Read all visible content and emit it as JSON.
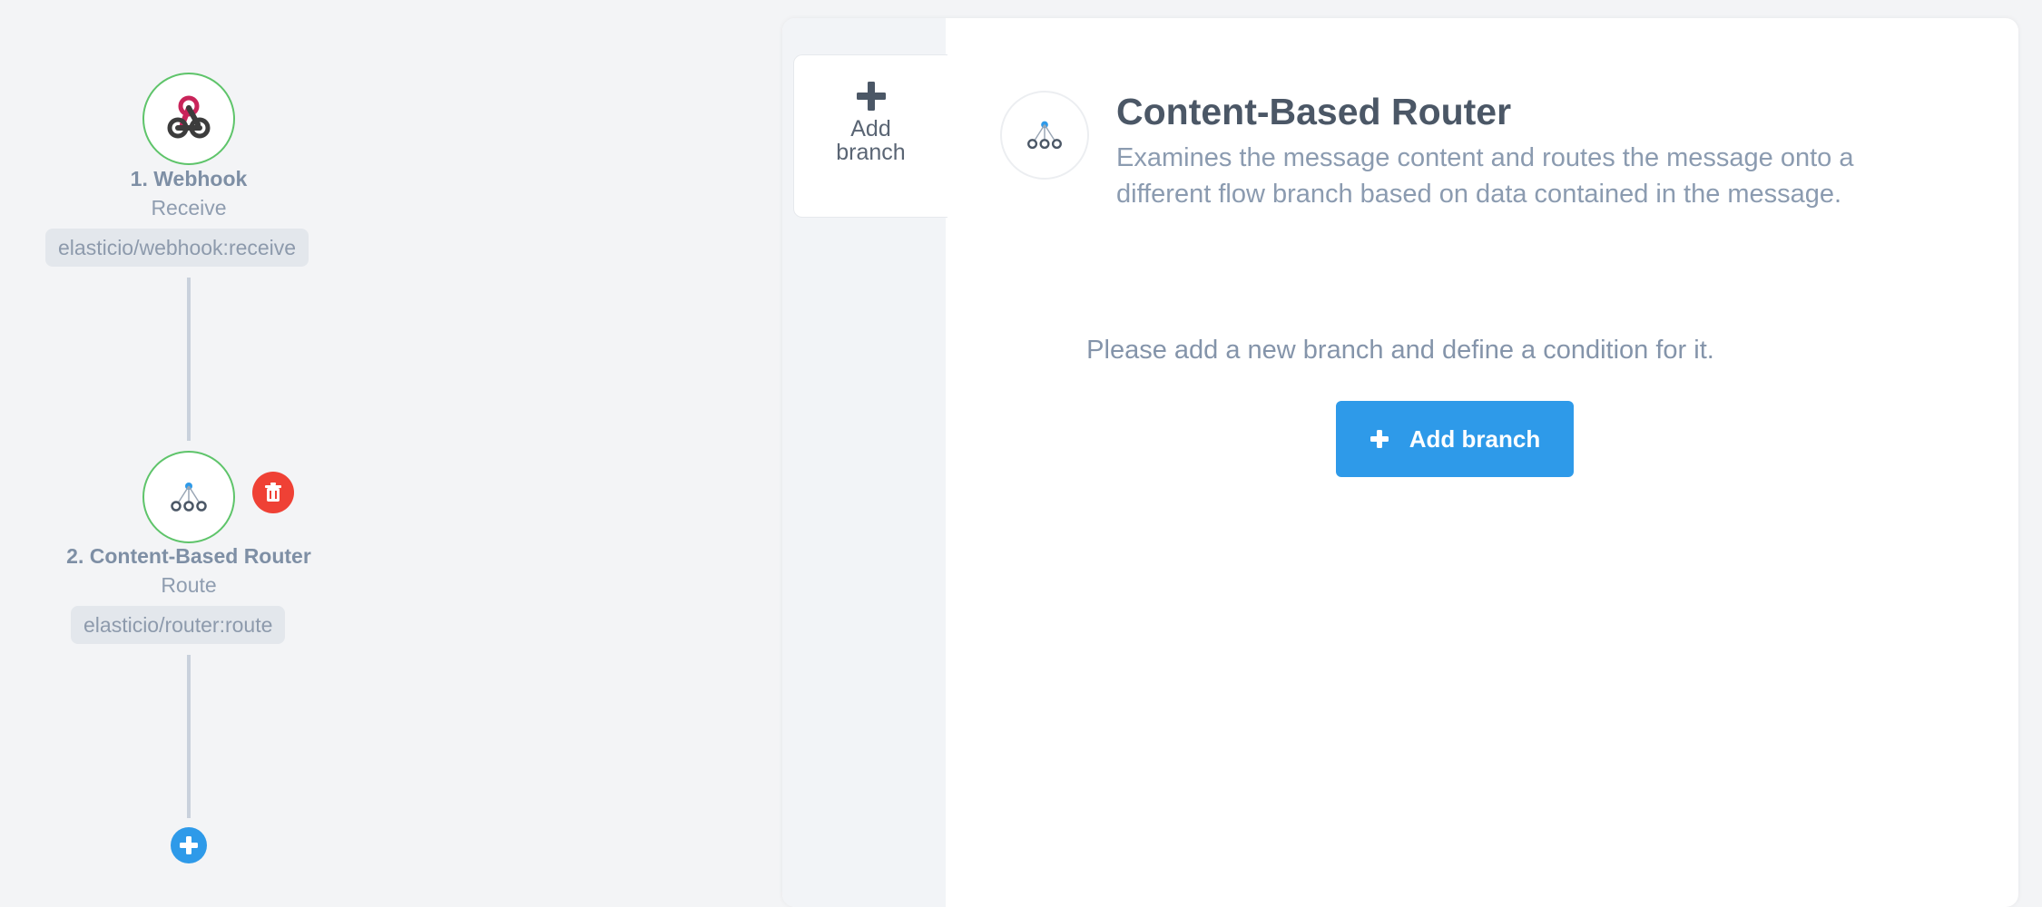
{
  "flow": {
    "steps": [
      {
        "title": "1. Webhook",
        "subtitle": "Receive",
        "tag": "elasticio/webhook:receive",
        "icon": "webhook-icon"
      },
      {
        "title": "2. Content-Based Router",
        "subtitle": "Route",
        "tag": "elasticio/router:route",
        "icon": "router-icon"
      }
    ],
    "delete_icon": "trash-icon",
    "add_step_icon": "plus-icon"
  },
  "panel": {
    "tab_add_branch_label": "Add branch",
    "component_title": "Content-Based Router",
    "component_description": "Examines the message content and routes the message onto a different flow branch based on data contained in the message.",
    "empty_message": "Please add a new branch and define a condition for it.",
    "add_branch_button": "Add branch"
  },
  "colors": {
    "accent": "#2e9ae9",
    "delete": "#ef4135",
    "success_ring": "#5ec46a",
    "webhook_pink": "#c9245a"
  }
}
